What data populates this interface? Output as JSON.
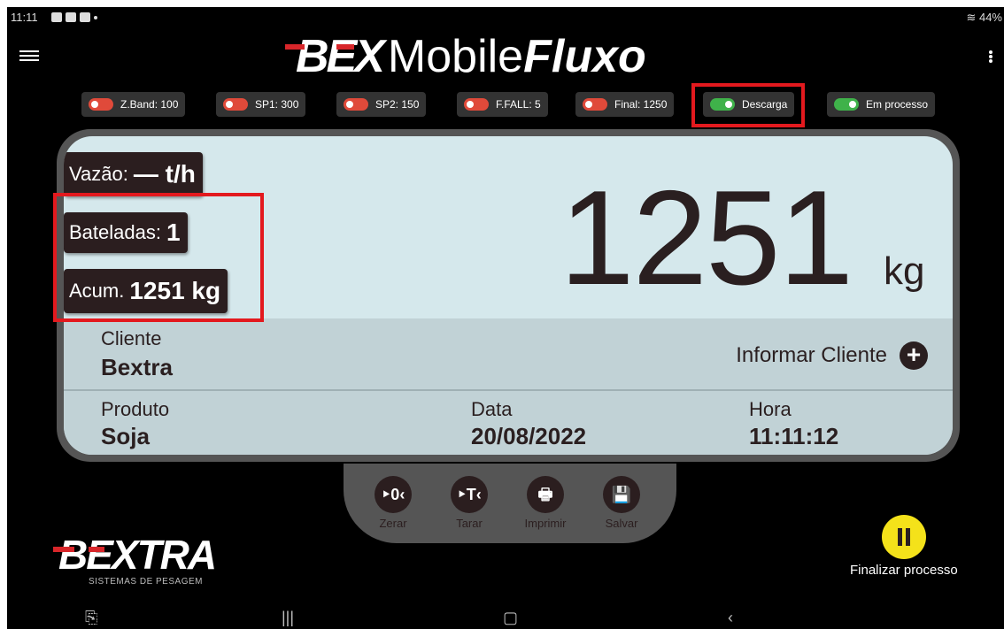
{
  "status_bar": {
    "time": "11:11",
    "battery": "44%"
  },
  "header": {
    "logo_bex": "BEX",
    "logo_mobile": "Mobile",
    "logo_fluxo": "Fluxo"
  },
  "toggles": [
    {
      "label": "Z.Band: 100",
      "on": false
    },
    {
      "label": "SP1: 300",
      "on": false
    },
    {
      "label": "SP2: 150",
      "on": false
    },
    {
      "label": "F.FALL: 5",
      "on": false
    },
    {
      "label": "Final: 1250",
      "on": false
    },
    {
      "label": "Descarga",
      "on": true
    },
    {
      "label": "Em processo",
      "on": true
    }
  ],
  "stats": {
    "vazao_label": "Vazão:",
    "vazao_value": "— t/h",
    "bateladas_label": "Bateladas:",
    "bateladas_value": "1",
    "acum_label": "Acum.",
    "acum_value": "1251 kg"
  },
  "weight": {
    "value": "1251",
    "unit": "kg"
  },
  "client": {
    "label": "Cliente",
    "value": "Bextra",
    "informar_label": "Informar Cliente"
  },
  "details": {
    "produto_label": "Produto",
    "produto_value": "Soja",
    "data_label": "Data",
    "data_value": "20/08/2022",
    "hora_label": "Hora",
    "hora_value": "11:11:12"
  },
  "actions": [
    {
      "glyph": "‣0‹",
      "label": "Zerar"
    },
    {
      "glyph": "‣T‹",
      "label": "Tarar"
    },
    {
      "glyph": "🖶",
      "label": "Imprimir"
    },
    {
      "glyph": "💾",
      "label": "Salvar"
    }
  ],
  "brand": {
    "name": "BEXTRA",
    "tagline": "SISTEMAS DE PESAGEM"
  },
  "finalize": {
    "label": "Finalizar processo"
  },
  "colors": {
    "accent_red": "#e3191e",
    "on_green": "#3fb24a",
    "off_red": "#e04a3a",
    "pause_yellow": "#f4e21a",
    "display_bg": "#d5e8ec"
  }
}
